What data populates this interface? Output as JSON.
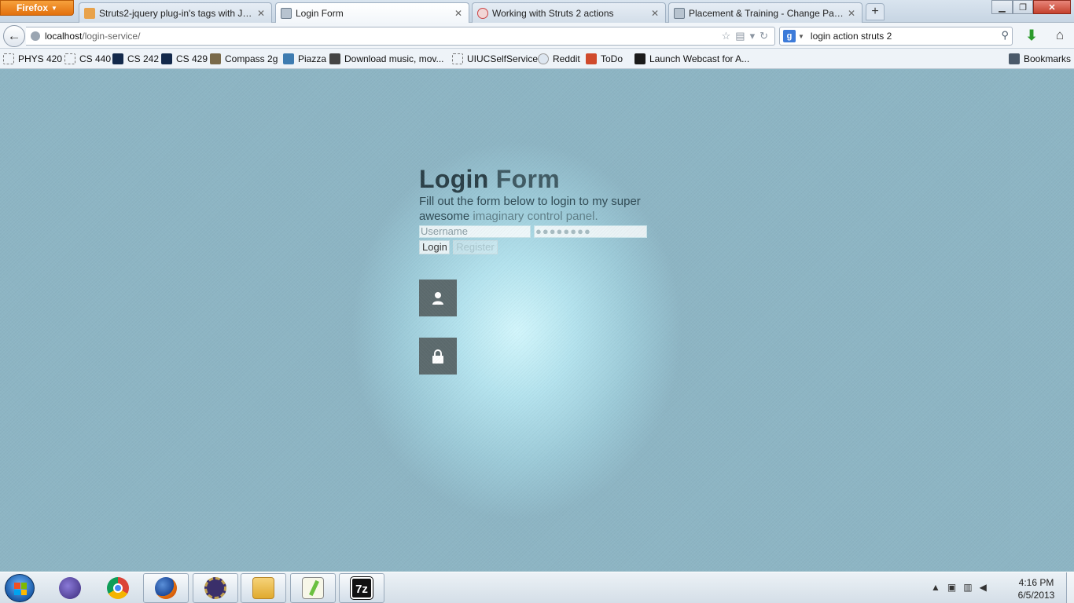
{
  "browser": {
    "menu_button": "Firefox",
    "tabs": [
      {
        "title": "Struts2-jquery plug-in's tags with Jqu...",
        "active": false
      },
      {
        "title": "Login Form",
        "active": true
      },
      {
        "title": "Working with Struts 2 actions",
        "active": false
      },
      {
        "title": "Placement & Training - Change Pass...",
        "active": false
      }
    ],
    "url_host": "localhost",
    "url_path": "/login-service/",
    "search_query": "login action struts 2",
    "search_engine_letter": "g",
    "bookmarks": [
      {
        "label": "PHYS 420",
        "icon": "blank-page-icon"
      },
      {
        "label": "CS 440",
        "icon": "blank-page-icon"
      },
      {
        "label": "CS 242",
        "icon": "illinois-icon"
      },
      {
        "label": "CS 429",
        "icon": "illinois-icon"
      },
      {
        "label": "Compass 2g",
        "icon": "blackboard-icon"
      },
      {
        "label": "Piazza",
        "icon": "piazza-icon"
      },
      {
        "label": "Download music, mov...",
        "icon": "couch-icon"
      },
      {
        "label": "UIUCSelfService",
        "icon": "blank-page-icon"
      },
      {
        "label": "Reddit",
        "icon": "reddit-icon"
      },
      {
        "label": "ToDo",
        "icon": "todo-icon"
      },
      {
        "label": "Launch Webcast for A...",
        "icon": "x-icon"
      }
    ],
    "bookmarks_menu": "Bookmarks"
  },
  "page": {
    "title_a": "Login ",
    "title_b": "Form",
    "desc_a": "Fill out the form below to login to my super awesome ",
    "desc_b": "imaginary control panel.",
    "username_placeholder": "Username",
    "password_mask": "●●●●●●●●",
    "login_button": "Login",
    "register_button": "Register"
  },
  "taskbar": {
    "apps": [
      "windows-start-icon",
      "eclipse-icon",
      "chrome-icon",
      "firefox-icon",
      "java-ee-ide-icon",
      "file-explorer-icon",
      "notepad-plus-icon",
      "7zip-icon"
    ],
    "clock_time": "4:16 PM",
    "clock_date": "6/5/2013"
  },
  "colors": {
    "page_bg": "#8db5c4",
    "page_glow": "#d2f6fc",
    "icon_box": "#5c6a6d",
    "firefox_orange": "#e2700d"
  }
}
